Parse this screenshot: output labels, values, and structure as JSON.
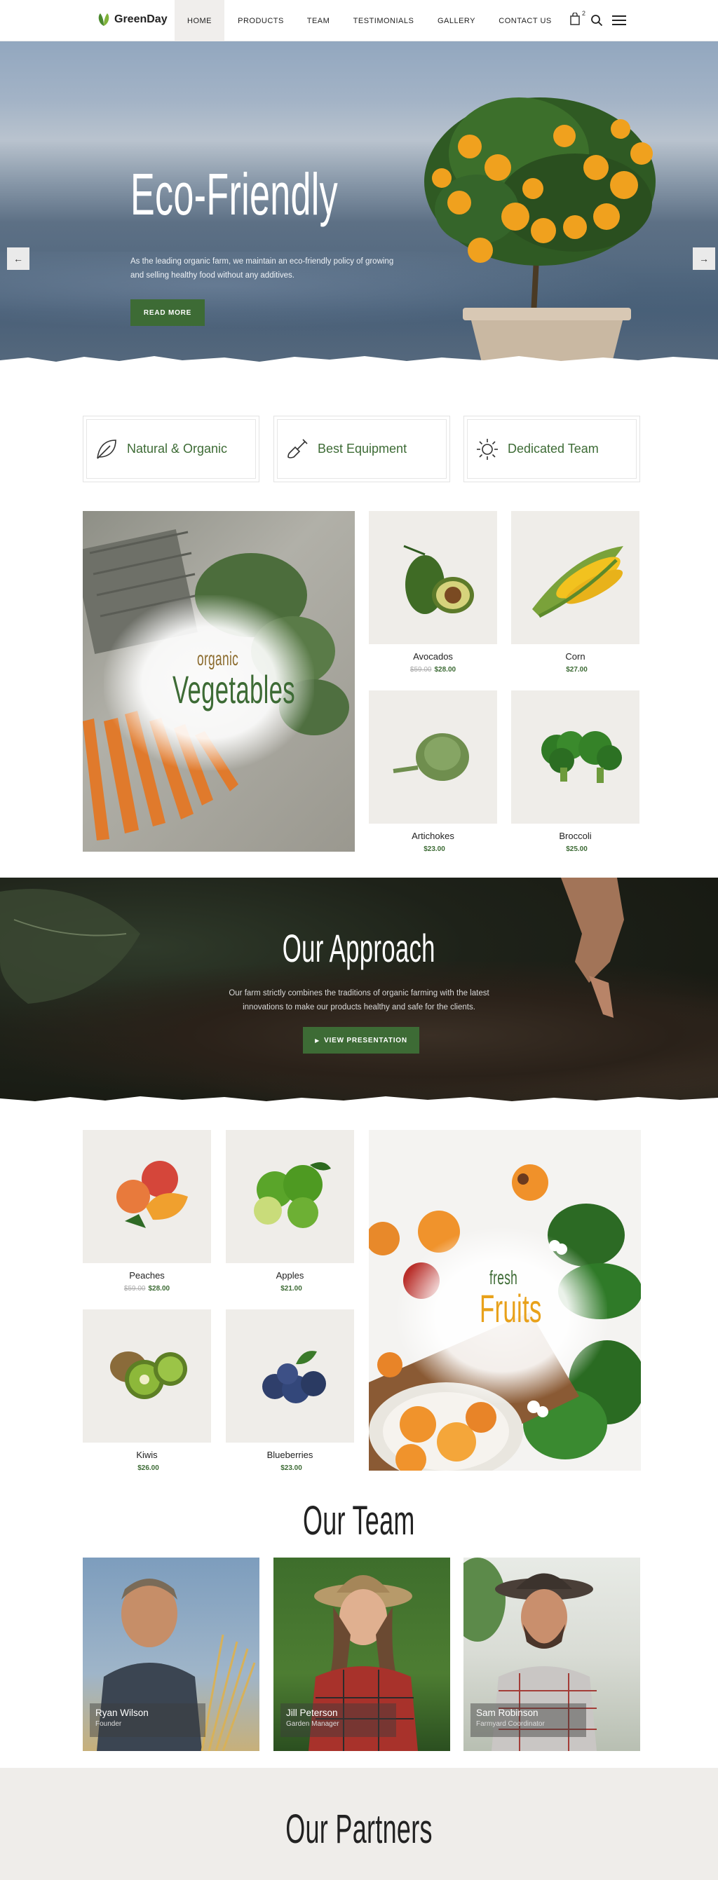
{
  "header": {
    "brand": "GreenDay",
    "nav": [
      "HOME",
      "PRODUCTS",
      "TEAM",
      "TESTIMONIALS",
      "GALLERY",
      "CONTACT US"
    ],
    "cart_count": "2"
  },
  "hero": {
    "title": "Eco-Friendly",
    "text": "As the leading organic farm, we maintain an eco-friendly policy of growing and selling healthy food without any additives.",
    "button": "READ MORE",
    "prev_icon": "arrow-left-icon",
    "next_icon": "arrow-right-icon"
  },
  "features": [
    {
      "label": "Natural & Organic",
      "icon": "leaf-icon"
    },
    {
      "label": "Best Equipment",
      "icon": "shovel-icon"
    },
    {
      "label": "Dedicated Team",
      "icon": "sun-icon"
    }
  ],
  "vegetables": {
    "banner_small": "organic",
    "banner_big": "Vegetables",
    "products": [
      {
        "name": "Avocados",
        "old_price": "$59.00",
        "price": "$28.00"
      },
      {
        "name": "Corn",
        "old_price": "",
        "price": "$27.00"
      },
      {
        "name": "Artichokes",
        "old_price": "",
        "price": "$23.00"
      },
      {
        "name": "Broccoli",
        "old_price": "",
        "price": "$25.00"
      }
    ]
  },
  "approach": {
    "title": "Our Approach",
    "text": "Our farm strictly combines the traditions of organic farming with the latest innovations to make our products healthy and safe for the clients.",
    "button": "VIEW PRESENTATION"
  },
  "fruits": {
    "banner_small": "fresh",
    "banner_big": "Fruits",
    "products": [
      {
        "name": "Peaches",
        "old_price": "$59.00",
        "price": "$28.00"
      },
      {
        "name": "Apples",
        "old_price": "",
        "price": "$21.00"
      },
      {
        "name": "Kiwis",
        "old_price": "",
        "price": "$26.00"
      },
      {
        "name": "Blueberries",
        "old_price": "",
        "price": "$23.00"
      }
    ]
  },
  "team": {
    "title": "Our Team",
    "members": [
      {
        "name": "Ryan Wilson",
        "role": "Founder"
      },
      {
        "name": "Jill Peterson",
        "role": "Garden Manager"
      },
      {
        "name": "Sam Robinson",
        "role": "Farmyard Coordinator"
      }
    ]
  },
  "partners": {
    "title": "Our Partners"
  },
  "colors": {
    "accent": "#3d6b35",
    "orange": "#e8a11a",
    "panel": "#efede9"
  }
}
